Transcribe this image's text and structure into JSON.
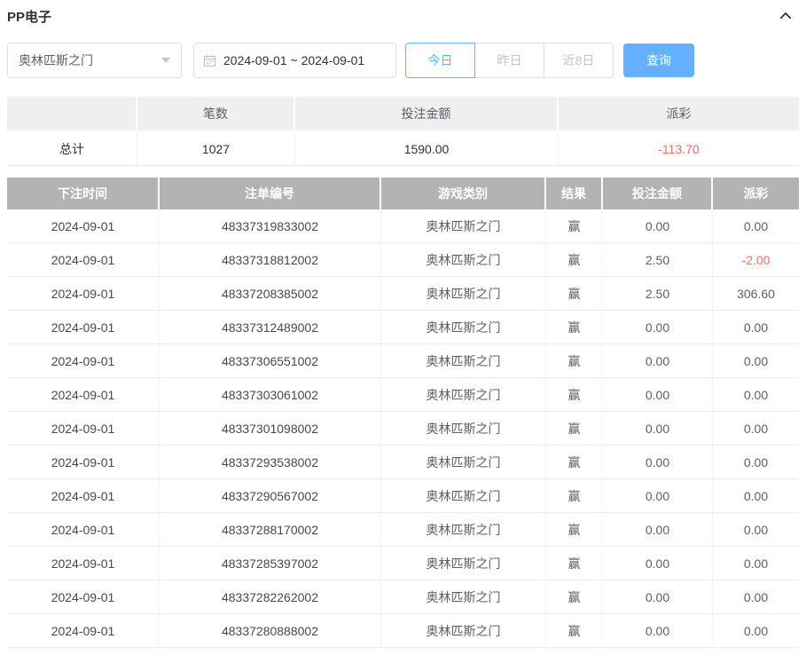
{
  "panel": {
    "title": "PP电子"
  },
  "filters": {
    "game_select": {
      "value": "奥林匹斯之门"
    },
    "date_range": {
      "value": "2024-09-01 ~ 2024-09-01"
    },
    "quick_buttons": [
      {
        "label": "今日",
        "active": true
      },
      {
        "label": "昨日",
        "active": false
      },
      {
        "label": "近8日",
        "active": false
      }
    ],
    "search_button_label": "查询"
  },
  "summary": {
    "headers": [
      "",
      "笔数",
      "投注金额",
      "派彩"
    ],
    "total": {
      "label": "总计",
      "count": "1027",
      "bet_amount": "1590.00",
      "payout": "-113.70",
      "payout_negative": true
    }
  },
  "table": {
    "headers": [
      "下注时间",
      "注单编号",
      "游戏类别",
      "结果",
      "投注金额",
      "派彩"
    ],
    "rows": [
      {
        "date": "2024-09-01",
        "order_no": "48337319833002",
        "game": "奥林匹斯之门",
        "result": "赢",
        "bet": "0.00",
        "payout": "0.00",
        "payout_negative": false
      },
      {
        "date": "2024-09-01",
        "order_no": "48337318812002",
        "game": "奥林匹斯之门",
        "result": "赢",
        "bet": "2.50",
        "payout": "-2.00",
        "payout_negative": true
      },
      {
        "date": "2024-09-01",
        "order_no": "48337208385002",
        "game": "奥林匹斯之门",
        "result": "赢",
        "bet": "2.50",
        "payout": "306.60",
        "payout_negative": false
      },
      {
        "date": "2024-09-01",
        "order_no": "48337312489002",
        "game": "奥林匹斯之门",
        "result": "赢",
        "bet": "0.00",
        "payout": "0.00",
        "payout_negative": false
      },
      {
        "date": "2024-09-01",
        "order_no": "48337306551002",
        "game": "奥林匹斯之门",
        "result": "赢",
        "bet": "0.00",
        "payout": "0.00",
        "payout_negative": false
      },
      {
        "date": "2024-09-01",
        "order_no": "48337303061002",
        "game": "奥林匹斯之门",
        "result": "赢",
        "bet": "0.00",
        "payout": "0.00",
        "payout_negative": false
      },
      {
        "date": "2024-09-01",
        "order_no": "48337301098002",
        "game": "奥林匹斯之门",
        "result": "赢",
        "bet": "0.00",
        "payout": "0.00",
        "payout_negative": false
      },
      {
        "date": "2024-09-01",
        "order_no": "48337293538002",
        "game": "奥林匹斯之门",
        "result": "赢",
        "bet": "0.00",
        "payout": "0.00",
        "payout_negative": false
      },
      {
        "date": "2024-09-01",
        "order_no": "48337290567002",
        "game": "奥林匹斯之门",
        "result": "赢",
        "bet": "0.00",
        "payout": "0.00",
        "payout_negative": false
      },
      {
        "date": "2024-09-01",
        "order_no": "48337288170002",
        "game": "奥林匹斯之门",
        "result": "赢",
        "bet": "0.00",
        "payout": "0.00",
        "payout_negative": false
      },
      {
        "date": "2024-09-01",
        "order_no": "48337285397002",
        "game": "奥林匹斯之门",
        "result": "赢",
        "bet": "0.00",
        "payout": "0.00",
        "payout_negative": false
      },
      {
        "date": "2024-09-01",
        "order_no": "48337282262002",
        "game": "奥林匹斯之门",
        "result": "赢",
        "bet": "0.00",
        "payout": "0.00",
        "payout_negative": false
      },
      {
        "date": "2024-09-01",
        "order_no": "48337280888002",
        "game": "奥林匹斯之门",
        "result": "赢",
        "bet": "0.00",
        "payout": "0.00",
        "payout_negative": false
      }
    ]
  },
  "colors": {
    "accent_blue": "#66b1ff",
    "negative_red": "#f56c6c",
    "table_header_bg": "#b3b3b3",
    "summary_header_bg": "#efefef"
  }
}
